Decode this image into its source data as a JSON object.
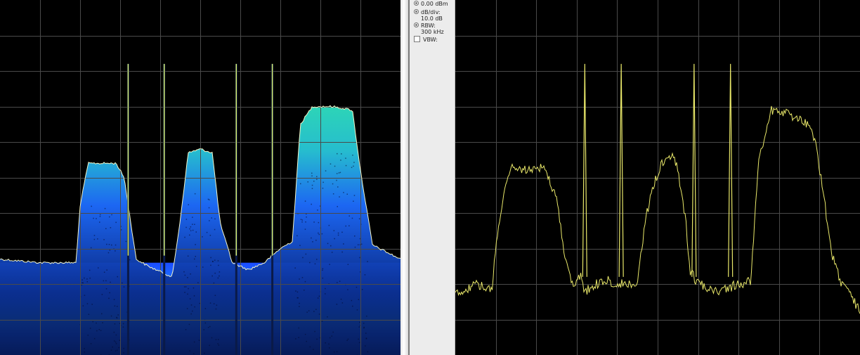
{
  "panel": {
    "ref_level": "0.00 dBm",
    "db_div_label": "dB/div:",
    "db_div_value": "10.0 dB",
    "rbw_label": "RBW:",
    "rbw_value": "300 kHz",
    "vbw_label": "VBW:"
  },
  "colors": {
    "grid": "#4a4a4a",
    "trace": "#e9e86a",
    "spectrogram_low": "#0a2a8a",
    "spectrogram_mid": "#1e6cff",
    "spectrogram_high": "#2fe0c0"
  },
  "chart_data": [
    {
      "type": "area",
      "name": "density-spectrum",
      "ylim": [
        -100,
        0
      ],
      "y_divisions": 10,
      "x_divisions": 10,
      "grid": true,
      "trace_points": [
        [
          0.0,
          -73
        ],
        [
          0.1,
          -74
        ],
        [
          0.19,
          -74
        ],
        [
          0.2,
          -58
        ],
        [
          0.22,
          -46
        ],
        [
          0.25,
          -46
        ],
        [
          0.29,
          -46
        ],
        [
          0.31,
          -50
        ],
        [
          0.34,
          -73
        ],
        [
          0.37,
          -75
        ],
        [
          0.41,
          -77
        ],
        [
          0.43,
          -78
        ],
        [
          0.45,
          -62
        ],
        [
          0.47,
          -43
        ],
        [
          0.5,
          -42
        ],
        [
          0.53,
          -43
        ],
        [
          0.55,
          -63
        ],
        [
          0.58,
          -74
        ],
        [
          0.62,
          -76
        ],
        [
          0.66,
          -74
        ],
        [
          0.7,
          -70
        ],
        [
          0.73,
          -68
        ],
        [
          0.75,
          -35
        ],
        [
          0.78,
          -30
        ],
        [
          0.83,
          -30
        ],
        [
          0.88,
          -31
        ],
        [
          0.9,
          -48
        ],
        [
          0.93,
          -69
        ],
        [
          1.0,
          -73
        ]
      ],
      "spurs": [
        {
          "x": 0.32,
          "level": -18
        },
        {
          "x": 0.41,
          "level": -18
        },
        {
          "x": 0.59,
          "level": -18
        },
        {
          "x": 0.68,
          "level": -18
        }
      ]
    },
    {
      "type": "line",
      "name": "live-spectrum-trace",
      "ylim": [
        -100,
        0
      ],
      "y_divisions": 10,
      "x_divisions": 10,
      "grid": true,
      "trace_points": [
        [
          0.0,
          -83
        ],
        [
          0.05,
          -80
        ],
        [
          0.09,
          -82
        ],
        [
          0.1,
          -70
        ],
        [
          0.12,
          -54
        ],
        [
          0.14,
          -47
        ],
        [
          0.18,
          -48
        ],
        [
          0.22,
          -47
        ],
        [
          0.25,
          -56
        ],
        [
          0.27,
          -72
        ],
        [
          0.29,
          -80
        ],
        [
          0.31,
          -78
        ],
        [
          0.32,
          -82
        ],
        [
          0.35,
          -80
        ],
        [
          0.38,
          -79
        ],
        [
          0.4,
          -80
        ],
        [
          0.45,
          -80
        ],
        [
          0.47,
          -62
        ],
        [
          0.49,
          -52
        ],
        [
          0.51,
          -46
        ],
        [
          0.54,
          -44
        ],
        [
          0.55,
          -48
        ],
        [
          0.57,
          -63
        ],
        [
          0.58,
          -76
        ],
        [
          0.6,
          -80
        ],
        [
          0.65,
          -82
        ],
        [
          0.7,
          -80
        ],
        [
          0.73,
          -79
        ],
        [
          0.75,
          -45
        ],
        [
          0.78,
          -31
        ],
        [
          0.82,
          -32
        ],
        [
          0.87,
          -35
        ],
        [
          0.89,
          -40
        ],
        [
          0.91,
          -55
        ],
        [
          0.93,
          -71
        ],
        [
          0.95,
          -79
        ],
        [
          0.98,
          -84
        ],
        [
          1.0,
          -88
        ]
      ],
      "spurs": [
        {
          "x": 0.32,
          "level": -18
        },
        {
          "x": 0.41,
          "level": -18
        },
        {
          "x": 0.59,
          "level": -18
        },
        {
          "x": 0.68,
          "level": -18
        }
      ]
    }
  ]
}
